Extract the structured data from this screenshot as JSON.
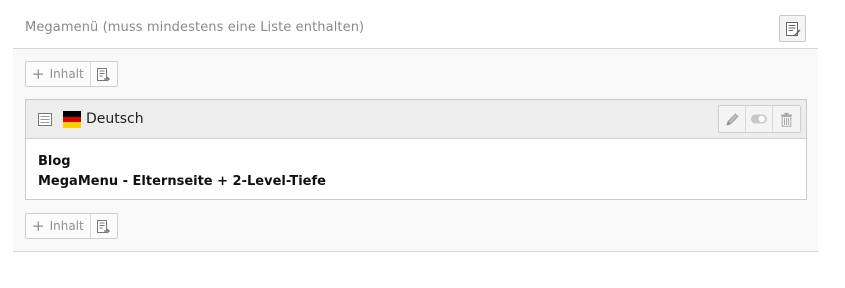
{
  "column": {
    "title": "Megamenü (muss mindestens eine Liste enthalten)",
    "header_button_icon": "edit-columns-icon"
  },
  "add_buttons": {
    "label": "Inhalt",
    "plus_icon": "plus-icon",
    "paste_icon": "paste-icon"
  },
  "element": {
    "type_icon": "content-element-icon",
    "flag_colors": [
      "#000000",
      "#dd0000",
      "#ffce00"
    ],
    "language": "Deutsch",
    "actions": [
      "edit-icon",
      "toggle-visibility-icon",
      "delete-icon"
    ],
    "lines": [
      "Blog",
      "MegaMenu - Elternseite + 2-Level-Tiefe"
    ]
  }
}
